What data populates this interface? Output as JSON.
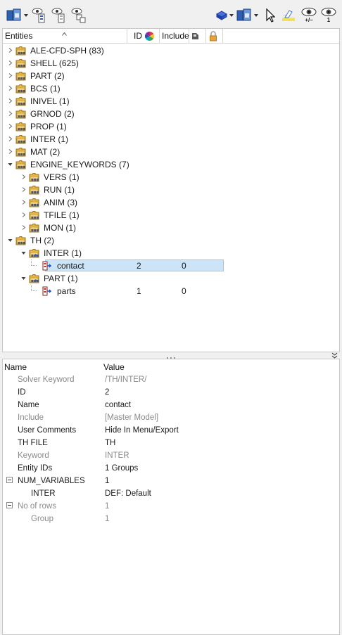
{
  "toolbar": {
    "icons": [
      "display-mode-icon",
      "dropdown-arrow-icon",
      "visibility-filter-icon",
      "tree-visibility-icon",
      "isolate-visibility-icon",
      "solid-display-icon",
      "display-dropdown-icon",
      "select-cursor-icon",
      "highlight-icon",
      "show-hide-toggle-icon",
      "show-one-icon"
    ],
    "show_hide_label": "+/–",
    "show_one_label": "1"
  },
  "entities": {
    "columns": {
      "entities": "Entities",
      "id": "ID",
      "include": "Include"
    },
    "tree": [
      {
        "label": "ALE-CFD-SPH",
        "count": "(83)"
      },
      {
        "label": "SHELL",
        "count": "(625)"
      },
      {
        "label": "PART",
        "count": "(2)"
      },
      {
        "label": "BCS",
        "count": "(1)"
      },
      {
        "label": "INIVEL",
        "count": "(1)"
      },
      {
        "label": "GRNOD",
        "count": "(2)"
      },
      {
        "label": "PROP",
        "count": "(1)"
      },
      {
        "label": "INTER",
        "count": "(1)"
      },
      {
        "label": "MAT",
        "count": "(2)"
      },
      {
        "label": "ENGINE_KEYWORDS",
        "count": "(7)"
      },
      {
        "label": "VERS",
        "count": "(1)"
      },
      {
        "label": "RUN",
        "count": "(1)"
      },
      {
        "label": "ANIM",
        "count": "(3)"
      },
      {
        "label": "TFILE",
        "count": "(1)"
      },
      {
        "label": "MON",
        "count": "(1)"
      },
      {
        "label": "TH",
        "count": "(2)"
      },
      {
        "label": "INTER",
        "count": "(1)"
      },
      {
        "label": "contact",
        "id": "2",
        "include": "0"
      },
      {
        "label": "PART",
        "count": "(1)"
      },
      {
        "label": "parts",
        "id": "1",
        "include": "0"
      }
    ]
  },
  "properties": {
    "columns": {
      "name": "Name",
      "value": "Value"
    },
    "rows": [
      {
        "name": "Solver Keyword",
        "value": "/TH/INTER/"
      },
      {
        "name": "ID",
        "value": "2"
      },
      {
        "name": "Name",
        "value": "contact"
      },
      {
        "name": "Include",
        "value": "[Master Model]"
      },
      {
        "name": "User Comments",
        "value": "Hide In Menu/Export"
      },
      {
        "name": "TH FILE",
        "value": "TH"
      },
      {
        "name": "Keyword",
        "value": "INTER"
      },
      {
        "name": "Entity IDs",
        "value": "1 Groups"
      },
      {
        "name": "NUM_VARIABLES",
        "value": "1"
      },
      {
        "name": "INTER",
        "value": "DEF: Default"
      },
      {
        "name": "No of rows",
        "value": "1"
      },
      {
        "name": "Group",
        "value": "1"
      }
    ]
  },
  "colors": {
    "selection": "#cce4f7",
    "folder": "#e6b94a",
    "muted_text": "#8a8a8a",
    "accent_blue": "#1f4fbf"
  }
}
